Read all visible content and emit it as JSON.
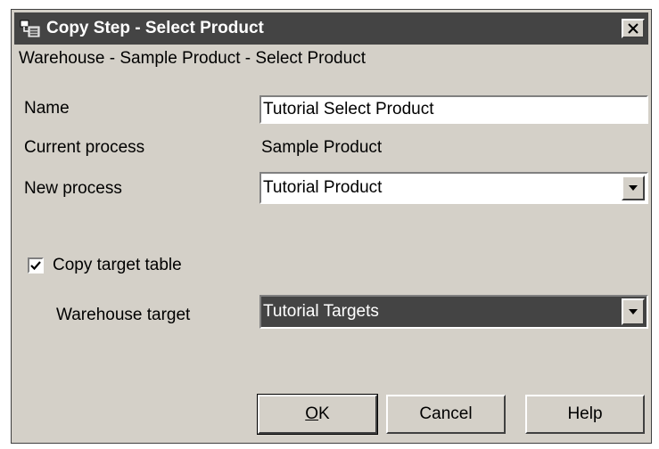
{
  "window": {
    "title": "Copy Step - Select Product",
    "close_glyph": "✕",
    "subtitle": "Warehouse - Sample Product - Select Product"
  },
  "form": {
    "name_label": "Name",
    "name_value": "Tutorial Select Product",
    "current_process_label": "Current process",
    "current_process_value": "Sample Product",
    "new_process_label": "New process",
    "new_process_value": "Tutorial Product",
    "copy_target_label": "Copy target table",
    "copy_target_checked": true,
    "warehouse_target_label": "Warehouse target",
    "warehouse_target_value": "Tutorial Targets"
  },
  "buttons": {
    "ok_mnemonic": "O",
    "ok_rest": "K",
    "cancel": "Cancel",
    "help": "Help"
  },
  "icons": {
    "title_icon": "copy-step-icon",
    "close_icon": "close-icon",
    "dropdown_icon": "chevron-down-icon",
    "check_icon": "checkmark-icon"
  }
}
